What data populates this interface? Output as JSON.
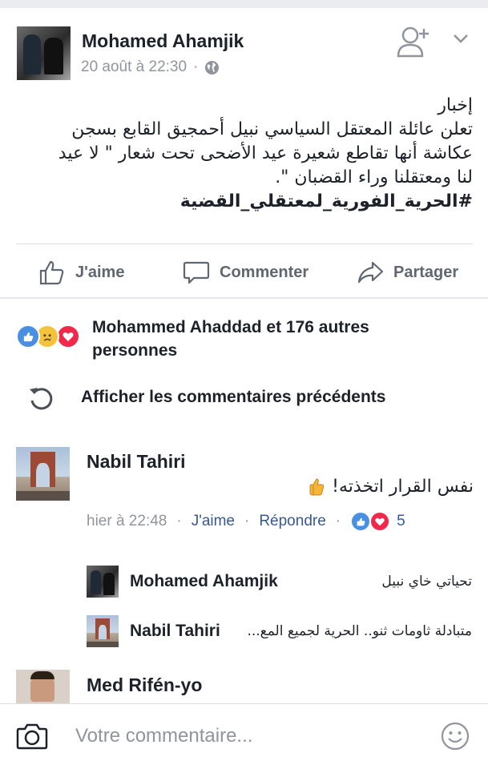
{
  "post": {
    "author": "Mohamed Ahamjik",
    "timestamp": "20 août à 22:30",
    "separator": "·",
    "privacy_icon": "globe-icon",
    "body_lines": [
      "إخبار",
      "تعلن عائلة المعتقل السياسي نبيل أحمجيق القابع بسجن",
      "عكاشة أنها تقاطع شعيرة عيد الأضحى تحت شعار \" لا عيد",
      "لنا ومعتقلنا وراء القضبان \"."
    ],
    "hashtag": "#الحرية_الفورية_لمعتقلي_القضية"
  },
  "actions": {
    "like": "J'aime",
    "comment": "Commenter",
    "share": "Partager"
  },
  "reactions": {
    "summary_line1": "Mohammed Ahaddad et 176 autres",
    "summary_line2": "personnes",
    "colors": {
      "like": "#4a90e2",
      "sad": "#f5c33b",
      "love": "#f0284a"
    }
  },
  "previous_comments_label": "Afficher les commentaires précédents",
  "comments": [
    {
      "name": "Nabil Tahiri",
      "text": "نفس القرار اتخذته!",
      "emoji": "👍",
      "time": "hier à 22:48",
      "like": "J'aime",
      "reply": "Répondre",
      "reaction_count": "5"
    }
  ],
  "replies": [
    {
      "name": "Mohamed Ahamjik",
      "text": "تحياتي خاي نبيل"
    },
    {
      "name": "Nabil Tahiri",
      "text": "متبادلة ثاومات ثنو.. الحرية لجميع المع..."
    }
  ],
  "next_comment": {
    "name": "Med Rifén-yo"
  },
  "composer": {
    "placeholder": "Votre commentaire..."
  }
}
